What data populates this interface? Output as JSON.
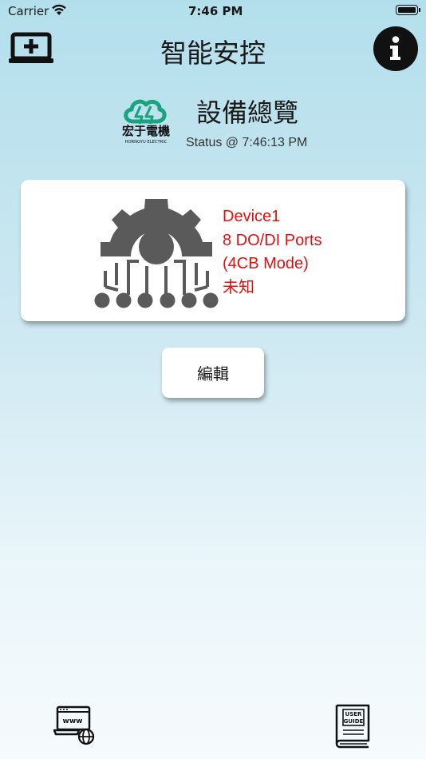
{
  "status_bar": {
    "carrier": "Carrier",
    "time": "7:46 PM",
    "wifi_icon": "wifi-icon",
    "battery_icon": "battery-icon"
  },
  "nav": {
    "title": "智能安控",
    "left_icon": "add-device-icon",
    "right_icon": "info-icon"
  },
  "overview": {
    "logo_text": "宏于電機",
    "logo_subtext": "HORNGYU ELECTRIC",
    "logo_color": "#1aa37f",
    "title": "設備總覽",
    "status": "Status @ 7:46:13 PM"
  },
  "device": {
    "icon": "gear-circuit-icon",
    "name": "Device1",
    "ports": "8 DO/DI Ports",
    "mode": "(4CB Mode)",
    "state": "未知",
    "text_color": "#e01010"
  },
  "edit_button": {
    "label": "編輯"
  },
  "bottom_bar": {
    "web": {
      "icon": "web-icon",
      "label": "www"
    },
    "guide": {
      "icon": "user-guide-icon",
      "label_line1": "USER",
      "label_line2": "GUIDE"
    }
  }
}
